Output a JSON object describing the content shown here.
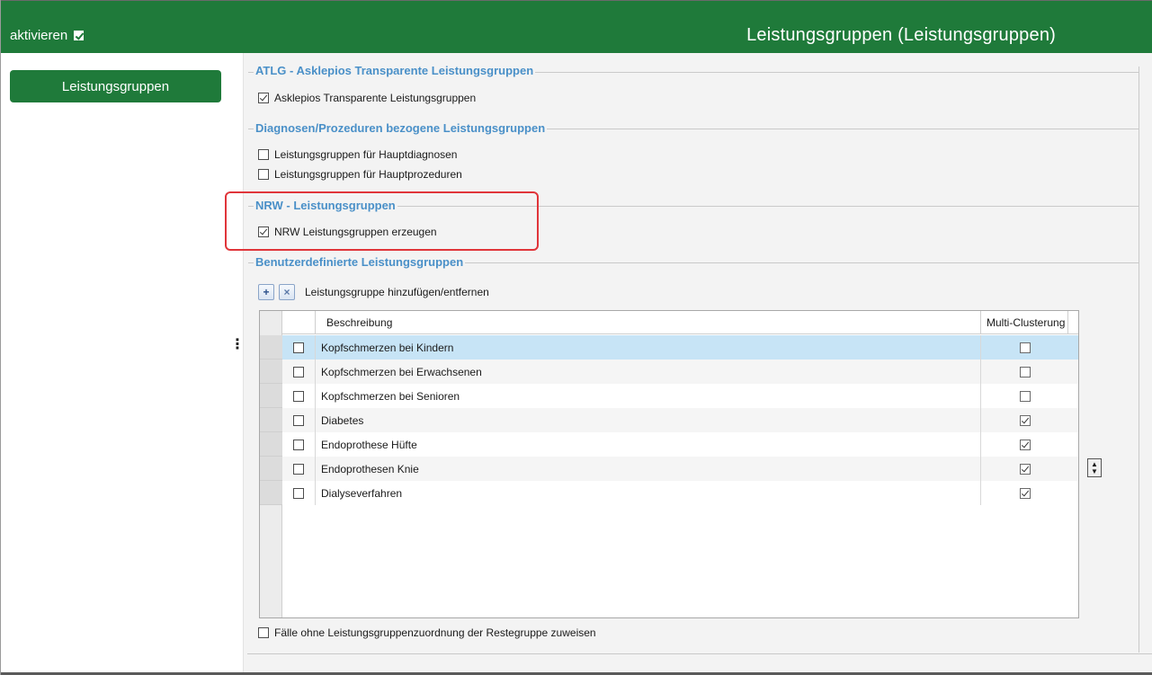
{
  "header": {
    "activate_label": "aktivieren",
    "activate_checked": true,
    "title": "Leistungsgruppen (Leistungsgruppen)"
  },
  "sidebar": {
    "items": [
      {
        "label": "Leistungsgruppen",
        "active": true
      }
    ]
  },
  "groups": {
    "atlg": {
      "title": "ATLG - Asklepios Transparente Leistungsgruppen",
      "options": [
        {
          "label": "Asklepios Transparente Leistungsgruppen",
          "checked": true
        }
      ]
    },
    "diagnosen": {
      "title": "Diagnosen/Prozeduren bezogene Leistungsgruppen",
      "options": [
        {
          "label": "Leistungsgruppen für Hauptdiagnosen",
          "checked": false
        },
        {
          "label": "Leistungsgruppen für Hauptprozeduren",
          "checked": false
        }
      ]
    },
    "nrw": {
      "title": "NRW - Leistungsgruppen",
      "options": [
        {
          "label": "NRW Leistungsgruppen erzeugen",
          "checked": true
        }
      ]
    },
    "custom": {
      "title": "Benutzerdefinierte Leistungsgruppen",
      "toolbar_label": "Leistungsgruppe hinzufügen/entfernen",
      "add_icon": "+",
      "remove_icon": "×",
      "columns": [
        "Beschreibung",
        "Multi-Clusterung"
      ],
      "rows": [
        {
          "description": "Kopfschmerzen bei Kindern",
          "selected": false,
          "multi": false,
          "highlighted": true
        },
        {
          "description": "Kopfschmerzen bei Erwachsenen",
          "selected": false,
          "multi": false,
          "highlighted": false
        },
        {
          "description": "Kopfschmerzen bei Senioren",
          "selected": false,
          "multi": false,
          "highlighted": false
        },
        {
          "description": "Diabetes",
          "selected": false,
          "multi": true,
          "highlighted": false
        },
        {
          "description": "Endoprothese Hüfte",
          "selected": false,
          "multi": true,
          "highlighted": false
        },
        {
          "description": "Endoprothesen Knie",
          "selected": false,
          "multi": true,
          "highlighted": false
        },
        {
          "description": "Dialyseverfahren",
          "selected": false,
          "multi": true,
          "highlighted": false
        }
      ],
      "rest_option": {
        "label": "Fälle ohne Leistungsgruppenzuordnung der Restegruppe zuweisen",
        "checked": false
      }
    }
  },
  "colors": {
    "brand_green": "#1f7a3a",
    "group_title_blue": "#4a90c8",
    "highlight_red": "#e0353a",
    "selected_row": "#c7e4f6"
  }
}
